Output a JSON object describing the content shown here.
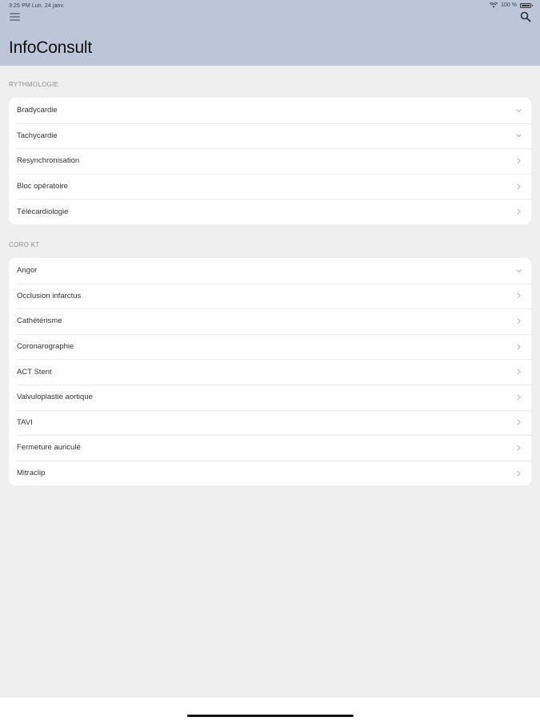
{
  "status_bar": {
    "time": "3:25 PM   Lun. 24 janv.",
    "battery": "100 %"
  },
  "header": {
    "title": "InfoConsult"
  },
  "sections": [
    {
      "title": "RYTHMOLOGIE",
      "items": [
        {
          "label": "Bradycardie",
          "indicator": "chevron-down"
        },
        {
          "label": "Tachycardie",
          "indicator": "chevron-down"
        },
        {
          "label": "Resynchronisation",
          "indicator": "chevron-right"
        },
        {
          "label": "Bloc opératoire",
          "indicator": "chevron-right"
        },
        {
          "label": "Télécardiologie",
          "indicator": "chevron-right"
        }
      ]
    },
    {
      "title": "CORO KT",
      "items": [
        {
          "label": "Angor",
          "indicator": "chevron-down"
        },
        {
          "label": "Occlusion infarctus",
          "indicator": "chevron-right"
        },
        {
          "label": "Cathétérisme",
          "indicator": "chevron-right"
        },
        {
          "label": "Coronarographie",
          "indicator": "chevron-right"
        },
        {
          "label": "ACT Stent",
          "indicator": "chevron-right"
        },
        {
          "label": "Valvuloplastie aortique",
          "indicator": "chevron-right"
        },
        {
          "label": "TAVI",
          "indicator": "chevron-right"
        },
        {
          "label": "Fermeture auricule",
          "indicator": "chevron-right"
        },
        {
          "label": "Mitraclip",
          "indicator": "chevron-right"
        }
      ]
    }
  ],
  "colors": {
    "header_bg": "#bdc6d8",
    "page_bg": "#efeff0",
    "chevron": "#b4b7bd"
  }
}
